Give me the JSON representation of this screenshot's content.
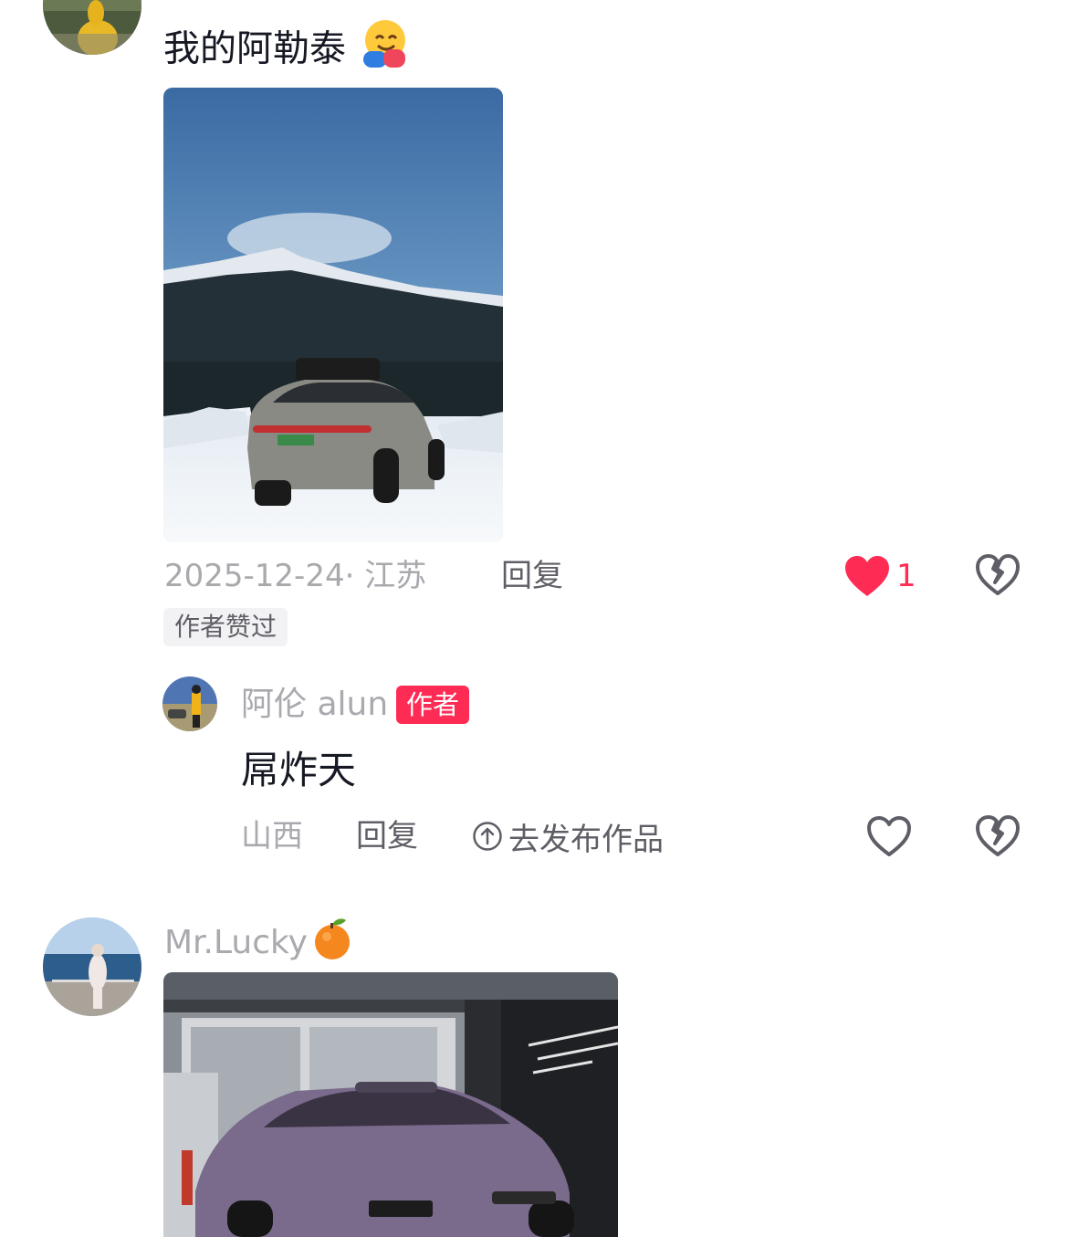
{
  "comment1": {
    "text": "我的阿勒泰",
    "emoji": "hugging-face-emoji",
    "date": "2025-12-24",
    "location_sep": "·",
    "location": "江苏",
    "reply_label": "回复",
    "like_count": "1",
    "liked": true,
    "author_liked_tag": "作者赞过",
    "image": "photo of grey SUV with roof box parked in snow in front of mountains"
  },
  "reply1": {
    "username": "阿伦 alun",
    "author_tag": "作者",
    "text": "屌炸天",
    "location": "山西",
    "reply_label": "回复",
    "publish_label": "去发布作品"
  },
  "comment2": {
    "username": "Mr.Lucky",
    "emoji": "tangerine-emoji",
    "image": "photo of purple SUV in front of a showroom building"
  },
  "colors": {
    "accent": "#fe2c55",
    "text": "#161823",
    "muted": "#a9a9ae",
    "secondary": "#5e5f66"
  }
}
